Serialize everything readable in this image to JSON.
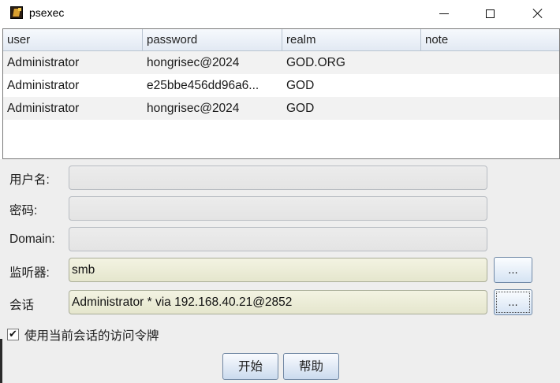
{
  "window": {
    "title": "psexec",
    "icon": "psexec-app-icon",
    "controls": [
      "minimize-icon",
      "maximize-icon",
      "close-icon"
    ]
  },
  "table": {
    "columns": [
      "user",
      "password",
      "realm",
      "note"
    ],
    "rows": [
      {
        "user": "Administrator",
        "password": "hongrisec@2024",
        "realm": "GOD.ORG",
        "note": ""
      },
      {
        "user": "Administrator",
        "password": "e25bbe456dd96a6...",
        "realm": "GOD",
        "note": ""
      },
      {
        "user": "Administrator",
        "password": "hongrisec@2024",
        "realm": "GOD",
        "note": ""
      }
    ]
  },
  "form": {
    "username_label": "用户名:",
    "username_value": "",
    "password_label": "密码:",
    "password_value": "",
    "domain_label": "Domain:",
    "domain_value": "",
    "listener_label": "监听器:",
    "listener_value": "smb",
    "session_label": "会话",
    "session_value": "Administrator * via  192.168.40.21@2852",
    "browse_label": "...",
    "use_token_label": "使用当前会话的访问令牌",
    "use_token_checked": true
  },
  "buttons": {
    "start": "开始",
    "help": "帮助"
  },
  "colors": {
    "header_bg": "#e2e9f3",
    "filled_field_bg": "#e5e6cd",
    "button_border": "#7087a3"
  }
}
